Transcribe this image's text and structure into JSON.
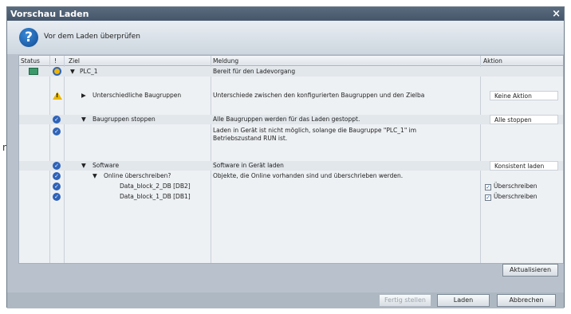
{
  "outer_label": "n",
  "window": {
    "title": "Vorschau Laden",
    "close": "×"
  },
  "header": {
    "label": "Vor dem Laden überprüfen"
  },
  "columns": {
    "status": "Status",
    "excl": "!",
    "ziel": "Ziel",
    "meldung": "Meldung",
    "aktion": "Aktion"
  },
  "rows": [
    {
      "ziel": "PLC_1",
      "meldung": "Bereit für den Ladevorgang",
      "aktion": ""
    },
    {
      "ziel": "Unterschiedliche Baugruppen",
      "meldung": "Unterschiede zwischen den konfigurierten Baugruppen und den Zielba",
      "aktion": "Keine Aktion"
    },
    {
      "ziel": "Baugruppen stoppen",
      "meldung": "Alle Baugruppen werden für das Laden gestoppt.",
      "aktion": "Alle stoppen"
    },
    {
      "ziel": "",
      "meldung": "Laden in Gerät ist nicht möglich, solange die Baugruppe \"PLC_1\" im",
      "meldung2": "Betriebszustand RUN ist.",
      "aktion": ""
    },
    {
      "ziel": "Software",
      "meldung": "Software in Gerät laden",
      "aktion": "Konsistent laden"
    },
    {
      "ziel": "Online überschreiben?",
      "meldung": "Objekte, die Online vorhanden sind und überschrieben werden.",
      "aktion": ""
    },
    {
      "ziel": "Data_block_2_DB [DB2]",
      "meldung": "",
      "aktion": "Überschreiben"
    },
    {
      "ziel": "Data_block_1_DB [DB1]",
      "meldung": "",
      "aktion": "Überschreiben"
    }
  ],
  "buttons": {
    "refresh": "Aktualisieren",
    "finish": "Fertig stellen",
    "load": "Laden",
    "cancel": "Abbrechen"
  }
}
